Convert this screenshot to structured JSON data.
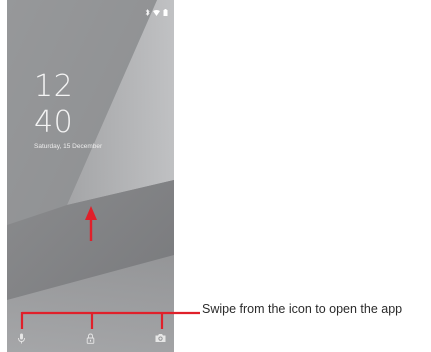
{
  "lockscreen": {
    "clock_hours": "12",
    "clock_minutes": "40",
    "date": "Saturday, 15 December"
  },
  "status_bar": {
    "icons": [
      "bluetooth-icon",
      "wifi-icon",
      "battery-icon"
    ]
  },
  "shortcuts": {
    "icons": [
      "microphone-icon",
      "lock-icon",
      "camera-icon"
    ]
  },
  "annotation": {
    "callout_text": "Swipe from the icon to open the app",
    "arrow_color": "#e0202a",
    "callout_line_color": "#e0202a"
  },
  "colors": {
    "wallpaper_base": "#8c8d8f",
    "wallpaper_light": "#c3c4c6",
    "wallpaper_dark": "#6f7072"
  }
}
